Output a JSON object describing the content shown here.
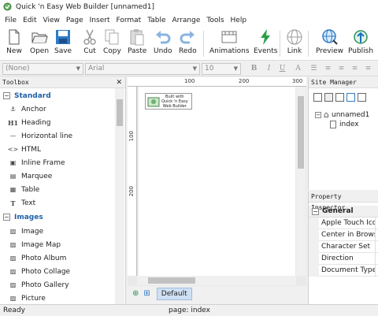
{
  "window": {
    "title": "Quick 'n Easy Web Builder [unnamed1]"
  },
  "menu": [
    "File",
    "Edit",
    "View",
    "Page",
    "Insert",
    "Format",
    "Table",
    "Arrange",
    "Tools",
    "Help"
  ],
  "toolbar": {
    "new": "New",
    "open": "Open",
    "save": "Save",
    "cut": "Cut",
    "copy": "Copy",
    "paste": "Paste",
    "undo": "Undo",
    "redo": "Redo",
    "animations": "Animations",
    "events": "Events",
    "link": "Link",
    "preview": "Preview",
    "publish": "Publish"
  },
  "format": {
    "style": "(None)",
    "font": "Arial",
    "size": "10"
  },
  "toolbox": {
    "title": "Toolbox",
    "standard": "Standard",
    "standard_items": [
      "Anchor",
      "Heading",
      "Horizontal line",
      "HTML",
      "Inline Frame",
      "Marquee",
      "Table",
      "Text"
    ],
    "images": "Images",
    "images_items": [
      "Image",
      "Image Map",
      "Photo Album",
      "Photo Collage",
      "Photo Gallery",
      "Picture"
    ]
  },
  "ruler": {
    "top": [
      "100",
      "200",
      "300"
    ],
    "left": [
      "100",
      "200"
    ]
  },
  "badge": {
    "line1": "Built with",
    "line2": "Quick 'n Easy",
    "line3": "Web Builder"
  },
  "pagetabs": {
    "default": "Default"
  },
  "site_manager": {
    "title": "Site Manager",
    "root": "unnamed1",
    "child": "index"
  },
  "property_inspector": {
    "title": "Property Inspector",
    "group": "General",
    "rows": [
      "Apple Touch Ico",
      "Center in Browse",
      "Character Set",
      "Direction",
      "Document Type"
    ]
  },
  "status": {
    "left": "Ready",
    "page": "page: index"
  },
  "colors": {
    "accent": "#2f7bc8",
    "events": "#27a046",
    "category": "#1f5fa8"
  }
}
